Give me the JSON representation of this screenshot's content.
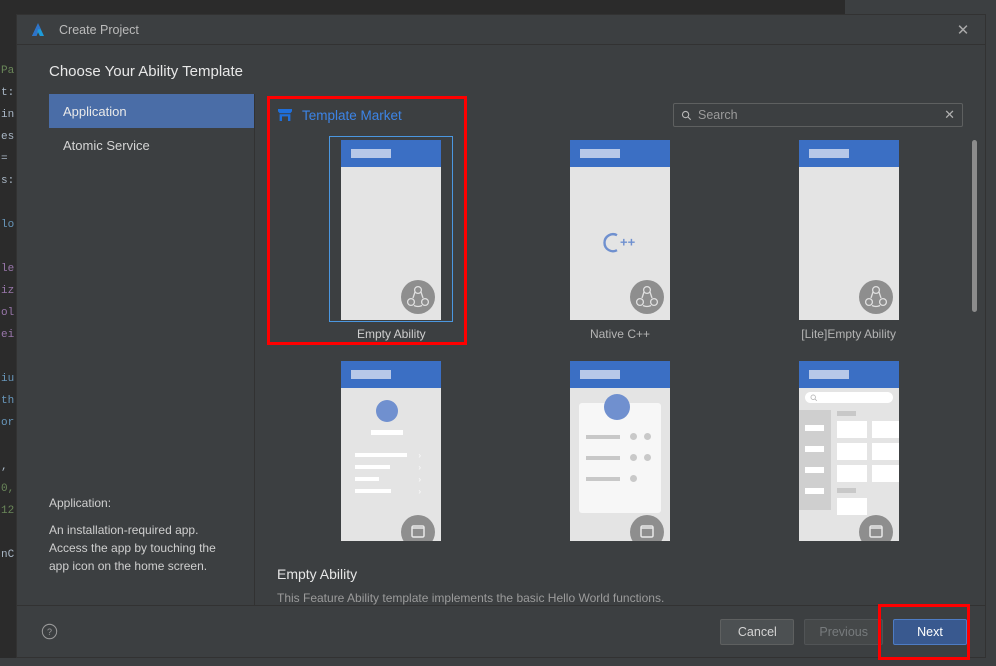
{
  "background": {
    "code_lines": [
      "Pa",
      "t:",
      "in",
      "es",
      "=",
      "s:",
      "",
      "lo",
      "",
      "le",
      "iz",
      "ol",
      "ei",
      "",
      "iu",
      "th",
      "or",
      "",
      ",",
      "0,",
      "12",
      "",
      "nC"
    ]
  },
  "titlebar": {
    "app_logo": "deveco-logo-icon",
    "title": "Create Project",
    "close_label": "✕"
  },
  "heading": "Choose Your Ability Template",
  "sidebar": {
    "items": [
      {
        "label": "Application",
        "selected": true
      },
      {
        "label": "Atomic Service",
        "selected": false
      }
    ],
    "description_title": "Application:",
    "description_body": "An installation-required app. Access the app by touching the app icon on the home screen."
  },
  "main": {
    "market_link": "Template Market",
    "market_icon": "store-icon",
    "search": {
      "icon": "search-icon",
      "placeholder": "Search",
      "value": "",
      "clear_label": "✕"
    },
    "templates": [
      {
        "label": "Empty Ability",
        "selected": true,
        "style": "blank"
      },
      {
        "label": "Native C++",
        "selected": false,
        "style": "cpp"
      },
      {
        "label": "[Lite]Empty Ability",
        "selected": false,
        "style": "blank"
      },
      {
        "label": "",
        "selected": false,
        "style": "list"
      },
      {
        "label": "",
        "selected": false,
        "style": "profile"
      },
      {
        "label": "",
        "selected": false,
        "style": "catalog"
      }
    ],
    "description_title": "Empty Ability",
    "description_body": "This Feature Ability template implements the basic Hello World functions."
  },
  "footer": {
    "help_icon": "help-circle-icon",
    "cancel_label": "Cancel",
    "previous_label": "Previous",
    "next_label": "Next"
  },
  "colors": {
    "accent": "#3c84e6",
    "selection": "#4a6da7",
    "primary_button": "#39598f",
    "card_border": "#4b97e0",
    "annotation": "#ff0000",
    "dialog_bg": "#3c3f41"
  }
}
